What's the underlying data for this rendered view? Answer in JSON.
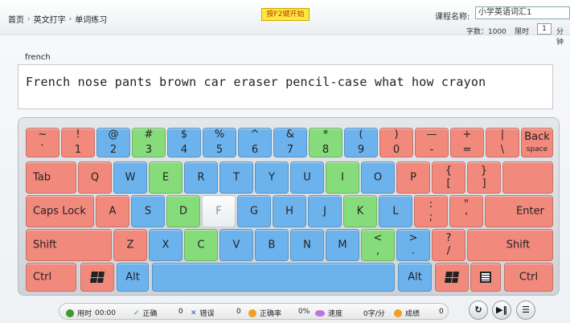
{
  "breadcrumb": [
    "首页",
    "英文打字",
    "单词练习"
  ],
  "start_button": "按F2键开始",
  "course": {
    "label": "课程名称:",
    "selected": "小学英语词汇1"
  },
  "word_count": "字数：1000",
  "time_limit": {
    "label": "限时",
    "value": "1",
    "unit": "分钟"
  },
  "current_word": "french",
  "practice_text": "French nose pants brown car eraser pencil-case what how crayon",
  "keys": {
    "tilde_top": "~",
    "tilde_bot": "`",
    "k1_top": "!",
    "k1_bot": "1",
    "k2_top": "@",
    "k2_bot": "2",
    "k3_top": "#",
    "k3_bot": "3",
    "k4_top": "$",
    "k4_bot": "4",
    "k5_top": "%",
    "k5_bot": "5",
    "k6_top": "^",
    "k6_bot": "6",
    "k7_top": "&",
    "k7_bot": "7",
    "k8_top": "*",
    "k8_bot": "8",
    "k9_top": "(",
    "k9_bot": "9",
    "k0_top": ")",
    "k0_bot": "0",
    "minus_top": "—",
    "minus_bot": "-",
    "plus_top": "+",
    "plus_bot": "=",
    "pipe_top": "|",
    "pipe_bot": "\\",
    "backspace_1": "Back",
    "backspace_2": "space",
    "tab": "Tab",
    "q": "Q",
    "w": "W",
    "e": "E",
    "r": "R",
    "t": "T",
    "y": "Y",
    "u": "U",
    "i": "I",
    "o": "O",
    "p": "P",
    "lbrace_top": "{",
    "lbrace_bot": "[",
    "rbrace_top": "}",
    "rbrace_bot": "]",
    "caps": "Caps Lock",
    "a": "A",
    "s": "S",
    "d": "D",
    "f": "F",
    "g": "G",
    "h": "H",
    "j": "J",
    "k": "K",
    "l": "L",
    "colon_top": ":",
    "colon_bot": ";",
    "quote_top": "\"",
    "quote_bot": "'",
    "enter": "Enter",
    "lshift": "Shift",
    "z": "Z",
    "x": "X",
    "c": "C",
    "v": "V",
    "b": "B",
    "n": "N",
    "m": "M",
    "lt_top": "<",
    "lt_bot": ",",
    "gt_top": ">",
    "gt_bot": ".",
    "q_top": "?",
    "q_bot": "/",
    "rshift": "Shift",
    "lctrl": "Ctrl",
    "lalt": "Alt",
    "ralt": "Alt",
    "rctrl": "Ctrl"
  },
  "status": {
    "time_label": "用时",
    "time_value": "00:00",
    "correct_label": "正确",
    "correct_value": "0",
    "error_label": "错误",
    "error_value": "0",
    "accuracy_label": "正确率",
    "accuracy_value": "0%",
    "speed_label": "速度",
    "speed_value": "0字/分",
    "score_label": "成绩",
    "score_value": "0"
  },
  "colors": {
    "left_pinky": "#f2897d",
    "index": "#6cb3ee",
    "ring": "#86dc7a",
    "highlight": "#ffffff"
  }
}
